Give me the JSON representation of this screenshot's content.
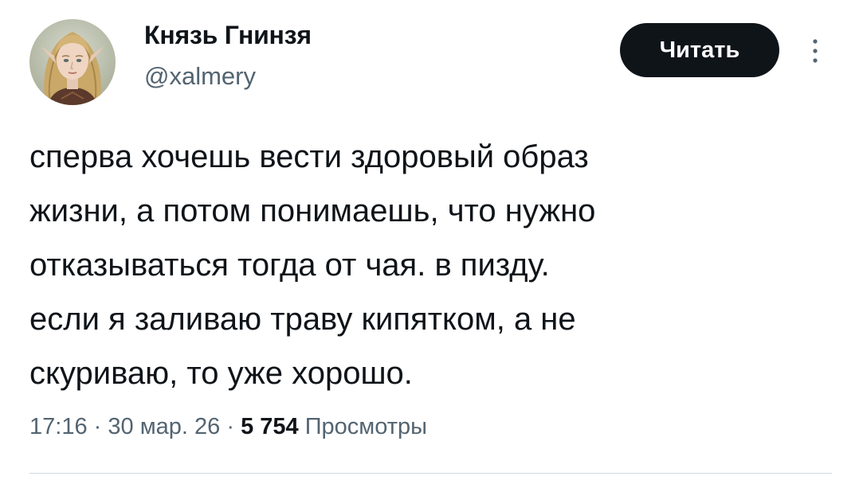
{
  "author": {
    "display_name": "Князь Гнинзя",
    "handle": "@xalmery",
    "avatar_icon": "avatar-portrait-elf-blonde"
  },
  "follow_button": {
    "label": "Читать"
  },
  "more_button": {
    "icon": "more-vertical-icon"
  },
  "tweet": {
    "lines": [
      "сперва хочешь вести здоровый образ",
      "жизни, а потом понимаешь, что нужно",
      "отказываться тогда от чая. в пизду.",
      "если я заливаю траву кипятком, а не",
      "скуриваю, то уже хорошо."
    ]
  },
  "meta": {
    "time": "17:16",
    "date": "30 мар. 26",
    "views_count": "5 754",
    "views_label": "Просмотры",
    "separator": "·"
  },
  "colors": {
    "text_primary": "#0f1419",
    "text_secondary": "#536471",
    "button_bg": "#0f1419",
    "divider": "#cfd9de"
  }
}
